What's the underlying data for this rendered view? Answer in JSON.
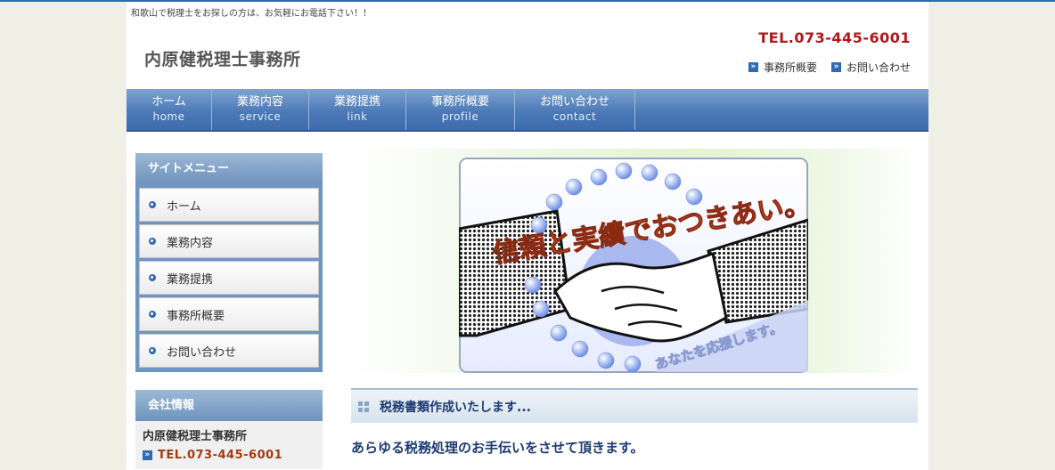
{
  "header": {
    "tagline": "和歌山で税理士をお探しの方は、お気軽にお電話下さい！！",
    "site_name": "内原健税理士事務所",
    "tel": "TEL.073-445-6001",
    "links": [
      "事務所概要",
      "お問い合わせ"
    ]
  },
  "nav": [
    {
      "ja": "ホーム",
      "en": "home"
    },
    {
      "ja": "業務内容",
      "en": "service"
    },
    {
      "ja": "業務提携",
      "en": "link"
    },
    {
      "ja": "事務所概要",
      "en": "profile"
    },
    {
      "ja": "お問い合わせ",
      "en": "contact"
    }
  ],
  "sidebar": {
    "menu_title": "サイトメニュー",
    "menu_items": [
      "ホーム",
      "業務内容",
      "業務提携",
      "事務所概要",
      "お問い合わせ"
    ],
    "company_title": "会社情報",
    "company_name": "内原健税理士事務所",
    "company_tel": "TEL.073-445-6001"
  },
  "hero": {
    "slogan": "信頼と実績でおつきあい。",
    "subtext": "あなたを応援します。"
  },
  "main": {
    "section_title": "税務書類作成いたします...",
    "lead": "あらゆる税務処理のお手伝いをさせて頂きます。"
  },
  "colors": {
    "accent_blue": "#2d6bb5",
    "tel_red": "#b0181b",
    "nav_blue": "#4c7ab8"
  }
}
